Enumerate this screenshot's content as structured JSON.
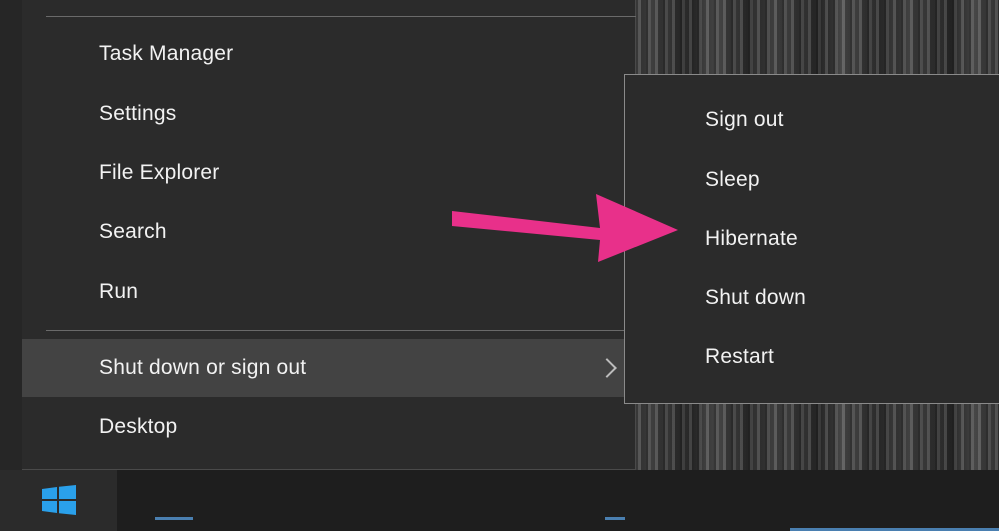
{
  "main_menu": {
    "items": [
      {
        "label": "Task Manager"
      },
      {
        "label": "Settings"
      },
      {
        "label": "File Explorer"
      },
      {
        "label": "Search"
      },
      {
        "label": "Run"
      },
      {
        "label": "Shut down or sign out"
      },
      {
        "label": "Desktop"
      }
    ],
    "highlighted_item": "Shut down or sign out",
    "submenu_indicator_icon": "chevron-right-icon"
  },
  "submenu": {
    "items": [
      {
        "label": "Sign out"
      },
      {
        "label": "Sleep"
      },
      {
        "label": "Hibernate"
      },
      {
        "label": "Shut down"
      },
      {
        "label": "Restart"
      }
    ],
    "annotated_item": "Hibernate"
  },
  "taskbar": {
    "start_icon": "windows-logo-icon"
  },
  "annotation": {
    "icon": "pointer-arrow-icon",
    "color": "#e8308a"
  },
  "colors": {
    "menu_background": "#2b2b2b",
    "menu_highlight": "#434343",
    "text": "#f2f2f2",
    "windows_logo": "#2aa0ea"
  }
}
